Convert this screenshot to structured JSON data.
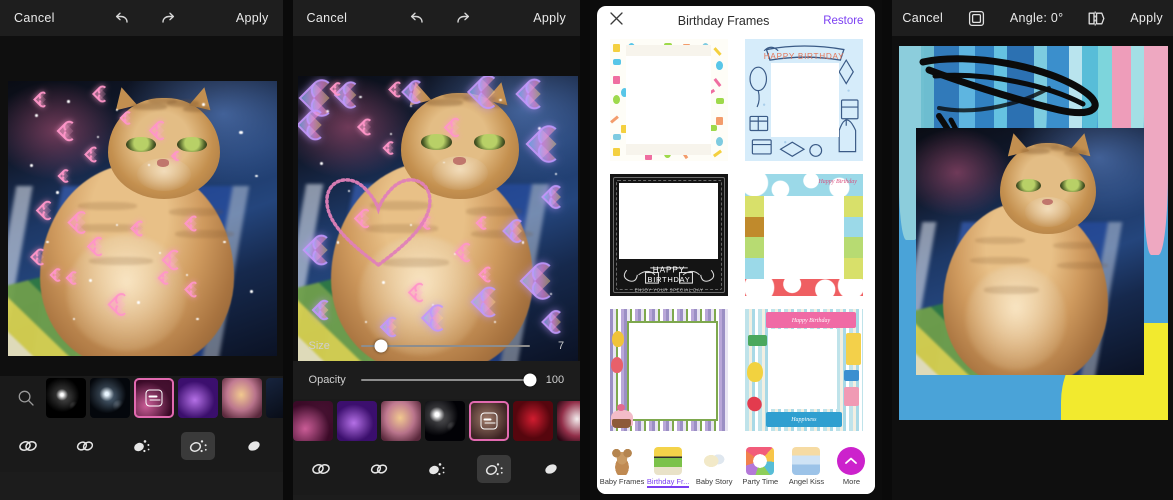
{
  "app": {
    "name": "photo-editor-screens"
  },
  "panel1": {
    "topbar": {
      "cancel": "Cancel",
      "undo_icon": "undo-icon",
      "redo_icon": "redo-icon",
      "apply": "Apply"
    },
    "canvas": {
      "subject": "orange tabby cat on blue blanket",
      "overlay": "pink heart stickers"
    },
    "brush_strip": {
      "search_icon": "search-icon",
      "items": [
        {
          "name": "white-sparkle-star-brush",
          "selected": false
        },
        {
          "name": "blue-sparkle-brush",
          "selected": false
        },
        {
          "name": "pink-hearts-brush",
          "selected": true
        },
        {
          "name": "purple-hearts-brush",
          "selected": false
        },
        {
          "name": "iridescent-hearts-brush",
          "selected": false
        },
        {
          "name": "dark-brush",
          "selected": false
        }
      ]
    },
    "tools": [
      {
        "name": "brush-link-tool",
        "active": false
      },
      {
        "name": "brush-chain-tool",
        "active": false
      },
      {
        "name": "brush-scatter-tool",
        "active": false
      },
      {
        "name": "brush-spray-tool",
        "active": true
      },
      {
        "name": "eraser-tool",
        "active": false
      }
    ]
  },
  "panel2": {
    "topbar": {
      "cancel": "Cancel",
      "undo_icon": "undo-icon",
      "redo_icon": "redo-icon",
      "apply": "Apply"
    },
    "canvas": {
      "subject": "orange tabby cat",
      "overlay": "iridescent bubble hearts and drawn heart outline"
    },
    "sliders": [
      {
        "label": "Size",
        "value": "7",
        "percent": 12
      },
      {
        "label": "Opacity",
        "value": "100",
        "percent": 100
      }
    ],
    "brush_strip": {
      "items": [
        {
          "name": "pink-hearts-brush",
          "selected": false
        },
        {
          "name": "purple-hearts-brush",
          "selected": false
        },
        {
          "name": "iridescent-hearts-brush",
          "selected": false
        },
        {
          "name": "white-sparkle-brush",
          "selected": false
        },
        {
          "name": "rose-pattern-brush",
          "selected": true
        },
        {
          "name": "red-petals-brush",
          "selected": false
        },
        {
          "name": "white-heart-brush",
          "selected": false
        }
      ]
    },
    "tools": [
      {
        "name": "brush-link-tool",
        "active": false
      },
      {
        "name": "brush-chain-tool",
        "active": false
      },
      {
        "name": "brush-scatter-tool",
        "active": false
      },
      {
        "name": "brush-spray-tool",
        "active": true
      },
      {
        "name": "eraser-tool",
        "active": false
      }
    ]
  },
  "panel3": {
    "header": {
      "close_icon": "close-icon",
      "title": "Birthday Frames",
      "restore": "Restore"
    },
    "frames": [
      {
        "name": "confetti-gifts-balloons-frame",
        "style": "confetti"
      },
      {
        "name": "blue-happy-birthday-doodle-frame",
        "style": "blue-doodle",
        "text": "HAPPY BIRTHDAY"
      },
      {
        "name": "chalkboard-happy-birthday-frame",
        "style": "chalkboard",
        "text": "HAPPY BIRTHDAY",
        "subtext": "ENJOY YOUR SPECIAL DAY"
      },
      {
        "name": "patchwork-happy-birthday-frame",
        "style": "patchwork",
        "text": "Happy Birthday"
      },
      {
        "name": "striped-balloons-cake-frame",
        "style": "striped"
      },
      {
        "name": "scrapbook-happiness-frame",
        "style": "scrapbook",
        "text": "Happy Birthday",
        "subtext": "Happiness"
      }
    ],
    "tabs": [
      {
        "label": "Baby Frames",
        "icon": "teddy-bear-icon",
        "selected": false
      },
      {
        "label": "Birthday Fr...",
        "icon": "birthday-cupcake-icon",
        "selected": true
      },
      {
        "label": "Baby Story",
        "icon": "baby-story-icon",
        "selected": false
      },
      {
        "label": "Party Time",
        "icon": "party-confetti-icon",
        "selected": false
      },
      {
        "label": "Angel Kiss",
        "icon": "angel-icon",
        "selected": false
      }
    ],
    "more": {
      "label": "More",
      "icon": "chevron-up-icon"
    }
  },
  "panel4": {
    "topbar": {
      "cancel": "Cancel",
      "frame_icon": "square-frame-icon",
      "angle": "Angle: 0°",
      "mirror_icon": "mirror-flip-icon",
      "apply": "Apply"
    },
    "canvas": {
      "subject": "orange tabby cat photo on painted abstract background"
    }
  },
  "colors": {
    "accent_purple": "#7b3ff2",
    "more_magenta": "#cc22cc",
    "selected_brush_border": "#e26ab0",
    "dark_bar": "#1e1e1e",
    "panel_bg": "#1c1c1c"
  }
}
